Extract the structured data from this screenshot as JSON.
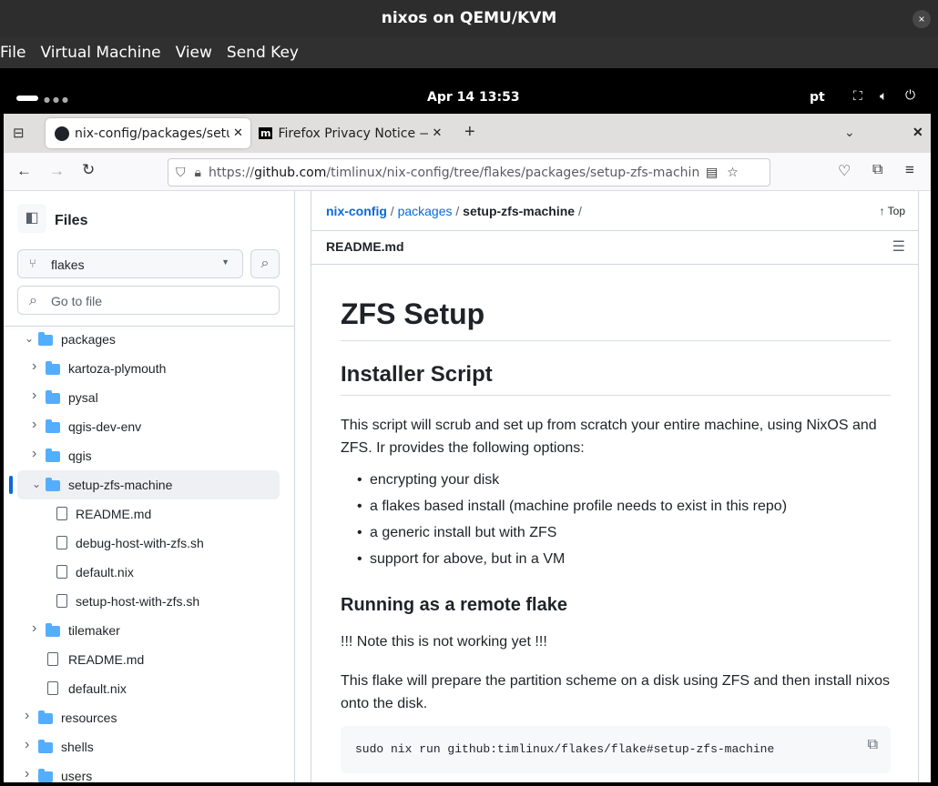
{
  "window": {
    "title": "nixos on QEMU/KVM",
    "close": "×",
    "menu": [
      "File",
      "Virtual Machine",
      "View",
      "Send Key"
    ]
  },
  "gnome": {
    "clock": "Apr 14  13:53",
    "keyboard": "pt"
  },
  "browser": {
    "tabs": [
      {
        "title": "nix-config/packages/setup-zfs-machine",
        "icon": "github-icon"
      },
      {
        "title": "Firefox Privacy Notice — Mozilla",
        "icon": "mozilla-icon"
      }
    ],
    "new_tab": "+",
    "url_prefix": "https://",
    "url_domain": "github.com",
    "url_path": "/timlinux/nix-config/tree/flakes/packages/setup-zfs-machine"
  },
  "sidebar": {
    "title": "Files",
    "branch": "flakes",
    "search_placeholder": "Go to file",
    "tree": [
      {
        "label": "packages",
        "type": "folder",
        "level": 0,
        "open": true
      },
      {
        "label": "kartoza-plymouth",
        "type": "folder",
        "level": 1
      },
      {
        "label": "pysal",
        "type": "folder",
        "level": 1
      },
      {
        "label": "qgis-dev-env",
        "type": "folder",
        "level": 1
      },
      {
        "label": "qgis",
        "type": "folder",
        "level": 1
      },
      {
        "label": "setup-zfs-machine",
        "type": "folder",
        "level": 1,
        "open": true,
        "selected": true
      },
      {
        "label": "README.md",
        "type": "file",
        "level": 2
      },
      {
        "label": "debug-host-with-zfs.sh",
        "type": "file",
        "level": 2
      },
      {
        "label": "default.nix",
        "type": "file",
        "level": 2
      },
      {
        "label": "setup-host-with-zfs.sh",
        "type": "file",
        "level": 2
      },
      {
        "label": "tilemaker",
        "type": "folder",
        "level": 1
      },
      {
        "label": "README.md",
        "type": "file",
        "level": 1
      },
      {
        "label": "default.nix",
        "type": "file",
        "level": 1
      },
      {
        "label": "resources",
        "type": "folder",
        "level": 0
      },
      {
        "label": "shells",
        "type": "folder",
        "level": 0
      },
      {
        "label": "users",
        "type": "folder",
        "level": 0
      }
    ]
  },
  "main": {
    "breadcrumb": [
      "nix-config",
      "packages",
      "setup-zfs-machine"
    ],
    "sep": "/",
    "top": "Top",
    "file": "README.md",
    "h1": "ZFS Setup",
    "h2": "Installer Script",
    "p1": "This script will scrub and set up from scratch your entire machine, using NixOS and ZFS. Ir provides the following options:",
    "bullets": [
      "encrypting your disk",
      "a flakes based install (machine profile needs to exist in this repo)",
      "a generic install but with ZFS",
      "support for above, but in a VM"
    ],
    "h3": "Running as a remote flake",
    "p2": "!!! Note this is not working yet !!!",
    "p3": "This flake will prepare the partition scheme on a disk using ZFS and then install nixos onto the disk.",
    "code": "sudo nix run github:timlinux/flakes/flake#setup-zfs-machine"
  },
  "colors": {
    "link": "#0969da",
    "folder": "#54aeff",
    "accent": "#0969da"
  }
}
